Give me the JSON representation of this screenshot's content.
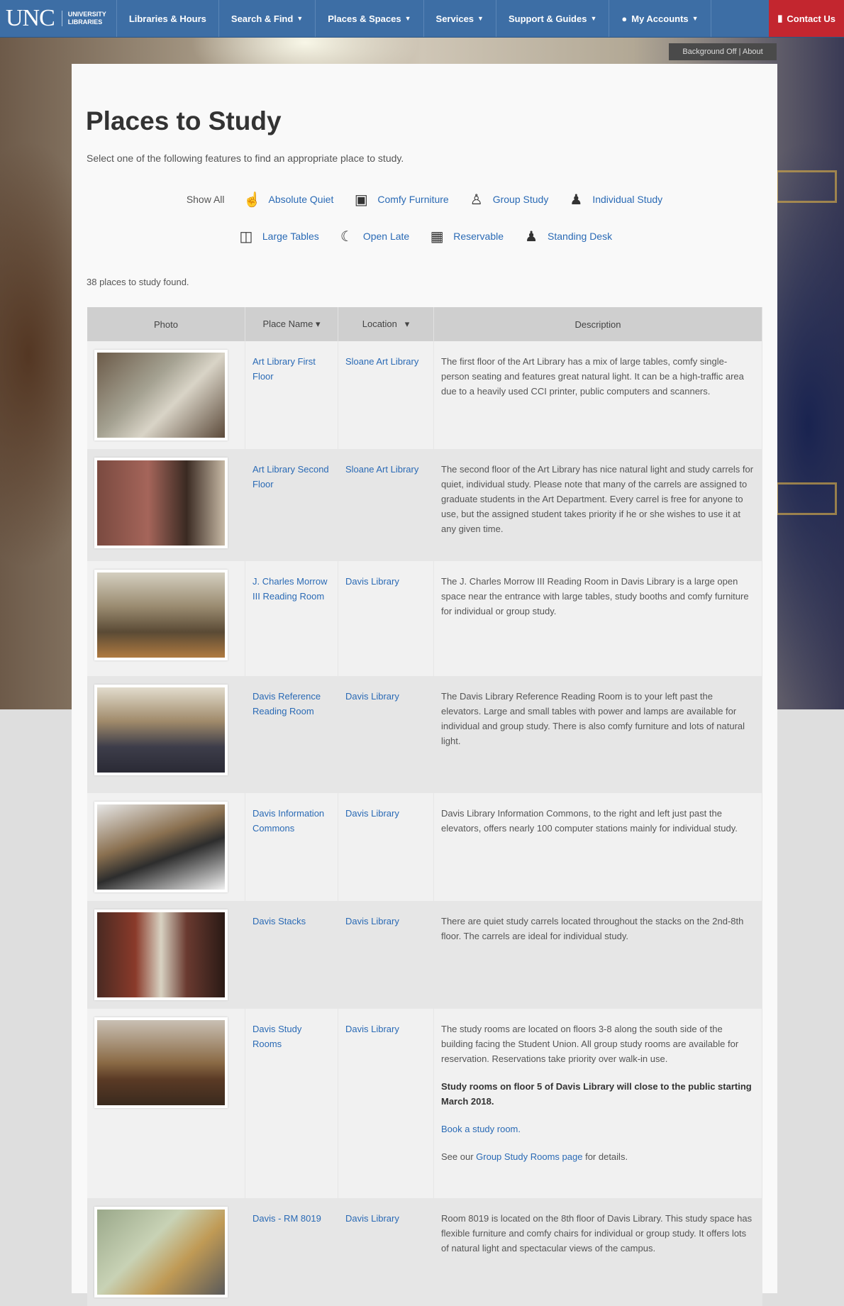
{
  "navbar": {
    "logo_text": "UNC",
    "logo_sub_line1": "UNIVERSITY",
    "logo_sub_line2": "LIBRARIES",
    "items": [
      {
        "label": "Libraries & Hours",
        "caret": ""
      },
      {
        "label": "Search & Find",
        "caret": "▼"
      },
      {
        "label": "Places & Spaces",
        "caret": "▼"
      },
      {
        "label": "Services",
        "caret": "▼"
      },
      {
        "label": "Support & Guides",
        "caret": "▼"
      },
      {
        "label": "My Accounts",
        "caret": "▼"
      }
    ],
    "contact_label": "Contact Us"
  },
  "background_toggle": "Background Off | About",
  "page": {
    "title": "Places to Study",
    "intro": "Select one of the following features to find an appropriate place to study.",
    "count": "38 places to study found."
  },
  "filters": {
    "show_all": "Show All",
    "row1": [
      {
        "label": "Absolute Quiet",
        "icon": "shush-icon"
      },
      {
        "label": "Comfy Furniture",
        "icon": "armchair-icon"
      },
      {
        "label": "Group Study",
        "icon": "group-icon"
      },
      {
        "label": "Individual Study",
        "icon": "person-icon"
      }
    ],
    "row2": [
      {
        "label": "Large Tables",
        "icon": "table-icon"
      },
      {
        "label": "Open Late",
        "icon": "moon-icon"
      },
      {
        "label": "Reservable",
        "icon": "calendar-icon"
      },
      {
        "label": "Standing Desk",
        "icon": "standing-icon"
      }
    ]
  },
  "table": {
    "headers": {
      "photo": "Photo",
      "name": "Place Name",
      "location": "Location",
      "description": "Description"
    },
    "rows": [
      {
        "name": "Art Library First Floor",
        "location": "Sloane Art Library",
        "desc": [
          "The first floor of the Art Library has a mix of large tables, comfy single-person seating and features great natural light. It can be a high-traffic area due to a heavily used CCI printer, public computers and scanners."
        ]
      },
      {
        "name": "Art Library Second Floor",
        "location": "Sloane Art Library",
        "desc": [
          "The second floor of the Art Library has nice natural light and study carrels for quiet, individual study. Please note that many of the carrels are assigned to graduate students in the Art Department. Every carrel is free for anyone to use, but the assigned student takes priority if he or she wishes to use it at any given time."
        ]
      },
      {
        "name": "J. Charles Morrow III Reading Room",
        "location": "Davis Library",
        "desc": [
          "The J. Charles Morrow III Reading Room in Davis Library is a large open space near the entrance with large tables, study booths and comfy furniture for individual or group study."
        ]
      },
      {
        "name": "Davis Reference Reading Room",
        "location": "Davis Library",
        "desc": [
          "The Davis Library Reference Reading Room is to your left past the elevators. Large and small tables with power and lamps are available for individual and group study. There is also comfy furniture and lots of natural light."
        ]
      },
      {
        "name": "Davis Information Commons",
        "location": "Davis Library",
        "desc": [
          "Davis Library Information Commons, to the right and left just past the elevators, offers nearly 100 computer stations mainly for individual study."
        ]
      },
      {
        "name": "Davis Stacks",
        "location": "Davis Library",
        "desc": [
          "There are quiet study carrels located throughout the stacks on the 2nd-8th floor. The carrels are ideal for individual study."
        ]
      },
      {
        "name": "Davis Study Rooms",
        "location": "Davis Library",
        "desc": [
          "The study rooms are located on floors 3-8 along the south side of the building facing the Student Union. All group study rooms are available for reservation. Reservations take priority over walk-in use."
        ],
        "bold": "Study rooms on floor 5 of Davis Library will close to the public starting March 2018.",
        "link": "Book a study room.",
        "see_pre": "See our ",
        "see_link": "Group Study Rooms page",
        "see_post": " for details."
      },
      {
        "name": "Davis - RM 8019",
        "location": "Davis Library",
        "desc": [
          "Room 8019 is located on the 8th floor of Davis Library. This study space has flexible furniture and comfy chairs for individual or group study. It offers lots of natural light and spectacular views of the campus."
        ]
      }
    ]
  }
}
